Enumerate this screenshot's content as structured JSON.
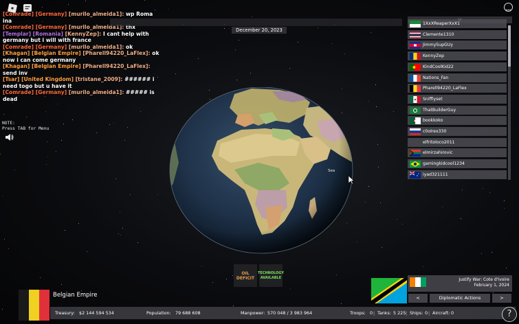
{
  "chat": [
    {
      "tag": "[Comrade]",
      "nation": "[Germany]",
      "user": "[murilo_almeida1]:",
      "msg": "wp Roma ina",
      "tag_class": "red"
    },
    {
      "tag": "[Comrade]",
      "nation": "[Germany]",
      "user": "[murilo_almeida1]:",
      "msg": "thx",
      "tag_class": "red"
    },
    {
      "tag": "[Templar]",
      "nation": "[Romania]",
      "user": "[KennyZep]:",
      "msg": "I cant help with germany but i will with france",
      "tag_class": "purple"
    },
    {
      "tag": "[Comrade]",
      "nation": "[Germany]",
      "user": "[murilo_almeida1]:",
      "msg": "ok",
      "tag_class": "red"
    },
    {
      "tag": "[Khagan]",
      "nation": "[Belgian Empire]",
      "user": "[Pharell94220_LaFlex]:",
      "msg": "ok now i can come germany",
      "tag_class": "orange"
    },
    {
      "tag": "[Khagan]",
      "nation": "[Belgian Empire]",
      "user": "[Pharell94220_LaFlex]:",
      "msg": "send inv",
      "tag_class": "orange"
    },
    {
      "tag": "[Tsar]",
      "nation": "[United Kingdom]",
      "user": "[tristane_2009]:",
      "msg": "###### i need togo but u have it",
      "tag_class": "orange"
    },
    {
      "tag": "[Comrade]",
      "nation": "[Germany]",
      "user": "[murilo_almeida1]:",
      "msg": "##### is dead",
      "tag_class": "red"
    }
  ],
  "date": "December 20, 2023",
  "note_line1": "NOTE:",
  "note_line2": "Press TAB for Menu",
  "globe_label": "Sea",
  "player_list_toggle": "v",
  "players": [
    {
      "name": "1XxXReaperXxX1",
      "flag": "green-white"
    },
    {
      "name": "Clemente1310",
      "flag": "thailand"
    },
    {
      "name": "JimmySupGUy",
      "flag": "cambodia"
    },
    {
      "name": "KennyZep",
      "flag": "romania"
    },
    {
      "name": "KindCoolKid22",
      "flag": "portugal"
    },
    {
      "name": "Nations_Fan",
      "flag": "france"
    },
    {
      "name": "Pharell94220_LaFlex",
      "flag": "belgium"
    },
    {
      "name": "Sniffiyset",
      "flag": "mexico"
    },
    {
      "name": "ThatBuilderGuy",
      "flag": "green-emblem"
    },
    {
      "name": "bookkoko",
      "flag": "algeria"
    },
    {
      "name": "c0olrex330",
      "flag": "russia"
    },
    {
      "name": "elfritoloco2011",
      "flag": "none"
    },
    {
      "name": "elmirzahirovic",
      "flag": "south-africa"
    },
    {
      "name": "gamingkidcool1234",
      "flag": "brazil"
    },
    {
      "name": "iyad321111",
      "flag": "australia"
    }
  ],
  "alerts": [
    {
      "label": "OIL DEFICIT",
      "color": "#e8a24a"
    },
    {
      "label": "TECHNOLOGY AVAILABLE",
      "color": "#7ee05a"
    }
  ],
  "country": {
    "name": "Belgian Empire",
    "treasury_label": "Treasury:",
    "treasury": "$2 144 594 534",
    "population_label": "Population:",
    "population": "79 688 608",
    "manpower_label": "Manpower:",
    "manpower": "570 048 / 3 983 964",
    "troops_label": "Troops:",
    "troops": "0",
    "tanks_label": "Tanks:",
    "tanks": "5 225",
    "ships_label": "Ships:",
    "ships": "0",
    "aircraft_label": "Aircraft:",
    "aircraft": "0"
  },
  "diplomacy": {
    "justify_line1": "Justify War: Cote d'Ivoire",
    "justify_line2": "February 1, 2024",
    "prev_label": "<",
    "actions_label": "Diplomatic Actions",
    "next_label": ">"
  },
  "help_label": "?"
}
